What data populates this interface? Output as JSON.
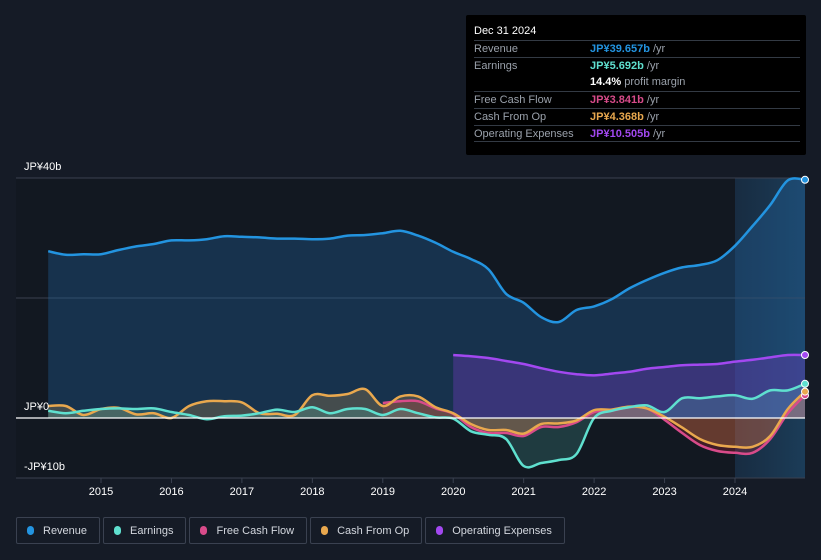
{
  "tooltip": {
    "date": "Dec 31 2024",
    "rows": [
      {
        "label": "Revenue",
        "value": "JP¥39.657b",
        "unit": " /yr",
        "color": "#2394e0"
      },
      {
        "label": "Earnings",
        "value": "JP¥5.692b",
        "unit": " /yr",
        "color": "#5fe0cf"
      },
      {
        "label": "",
        "value": "14.4%",
        "unit": " profit margin",
        "color": "#ffffff"
      },
      {
        "label": "Free Cash Flow",
        "value": "JP¥3.841b",
        "unit": " /yr",
        "color": "#d84b8a"
      },
      {
        "label": "Cash From Op",
        "value": "JP¥4.368b",
        "unit": " /yr",
        "color": "#e9a84e"
      },
      {
        "label": "Operating Expenses",
        "value": "JP¥10.505b",
        "unit": " /yr",
        "color": "#a248f0"
      }
    ]
  },
  "legend": [
    {
      "label": "Revenue",
      "color": "#2394e0"
    },
    {
      "label": "Earnings",
      "color": "#5fe0cf"
    },
    {
      "label": "Free Cash Flow",
      "color": "#d84b8a"
    },
    {
      "label": "Cash From Op",
      "color": "#e9a84e"
    },
    {
      "label": "Operating Expenses",
      "color": "#a248f0"
    }
  ],
  "chart_data": {
    "type": "line",
    "title": "",
    "xlabel": "",
    "ylabel": "",
    "y_tick_labels": [
      "JP¥40b",
      "JP¥0",
      "-JP¥10b"
    ],
    "y_ticks": [
      40,
      0,
      -10
    ],
    "ylim": [
      -10,
      40
    ],
    "xlim": [
      2014.0,
      2025.0
    ],
    "x_tick_labels": [
      "2015",
      "2016",
      "2017",
      "2018",
      "2019",
      "2020",
      "2021",
      "2022",
      "2023",
      "2024"
    ],
    "x_ticks": [
      2015,
      2016,
      2017,
      2018,
      2019,
      2020,
      2021,
      2022,
      2023,
      2024
    ],
    "grid": true,
    "legend_position": "bottom-left",
    "highlight_start": 2024.0,
    "series": [
      {
        "name": "Revenue",
        "color": "#2394e0",
        "x": [
          2014.25,
          2014.5,
          2014.75,
          2015.0,
          2015.25,
          2015.5,
          2015.75,
          2016.0,
          2016.25,
          2016.5,
          2016.75,
          2017.0,
          2017.25,
          2017.5,
          2017.75,
          2018.0,
          2018.25,
          2018.5,
          2018.75,
          2019.0,
          2019.25,
          2019.5,
          2019.75,
          2020.0,
          2020.25,
          2020.5,
          2020.75,
          2021.0,
          2021.25,
          2021.5,
          2021.75,
          2022.0,
          2022.25,
          2022.5,
          2022.75,
          2023.0,
          2023.25,
          2023.5,
          2023.75,
          2024.0,
          2024.25,
          2024.5,
          2024.75,
          2025.0
        ],
        "values": [
          27.8,
          27.2,
          27.3,
          27.3,
          28.0,
          28.6,
          29.0,
          29.6,
          29.6,
          29.8,
          30.3,
          30.2,
          30.1,
          29.9,
          29.9,
          29.8,
          29.9,
          30.4,
          30.5,
          30.8,
          31.2,
          30.4,
          29.2,
          27.7,
          26.5,
          24.8,
          20.7,
          19.2,
          16.8,
          16.0,
          18.0,
          18.6,
          19.8,
          21.6,
          23.0,
          24.2,
          25.1,
          25.5,
          26.3,
          28.7,
          32.0,
          35.5,
          39.6,
          39.7
        ]
      },
      {
        "name": "Earnings",
        "color": "#5fe0cf",
        "x": [
          2014.25,
          2014.5,
          2014.75,
          2015.0,
          2015.25,
          2015.5,
          2015.75,
          2016.0,
          2016.25,
          2016.5,
          2016.75,
          2017.0,
          2017.25,
          2017.5,
          2017.75,
          2018.0,
          2018.25,
          2018.5,
          2018.75,
          2019.0,
          2019.25,
          2019.5,
          2019.75,
          2020.0,
          2020.25,
          2020.5,
          2020.75,
          2021.0,
          2021.25,
          2021.5,
          2021.75,
          2022.0,
          2022.25,
          2022.5,
          2022.75,
          2023.0,
          2023.25,
          2023.5,
          2023.75,
          2024.0,
          2024.25,
          2024.5,
          2024.75,
          2025.0
        ],
        "values": [
          1.2,
          0.8,
          1.2,
          1.5,
          1.6,
          1.5,
          1.6,
          1.0,
          0.5,
          -0.2,
          0.3,
          0.4,
          0.8,
          1.4,
          1.0,
          1.8,
          0.8,
          1.5,
          1.5,
          0.5,
          1.5,
          0.8,
          0.1,
          -0.1,
          -2.2,
          -2.8,
          -3.5,
          -8.0,
          -7.5,
          -7.0,
          -6.0,
          0.0,
          1.2,
          1.8,
          2.1,
          1.0,
          3.3,
          3.3,
          3.6,
          3.8,
          3.2,
          4.6,
          4.6,
          5.7
        ]
      },
      {
        "name": "Free Cash Flow",
        "color": "#d84b8a",
        "x": [
          2019.0,
          2019.25,
          2019.5,
          2019.75,
          2020.0,
          2020.25,
          2020.5,
          2020.75,
          2021.0,
          2021.25,
          2021.5,
          2021.75,
          2022.0,
          2022.25,
          2022.5,
          2022.75,
          2023.0,
          2023.25,
          2023.5,
          2023.75,
          2024.0,
          2024.25,
          2024.5,
          2024.75,
          2025.0
        ],
        "values": [
          2.5,
          2.8,
          2.8,
          1.6,
          0.7,
          -1.5,
          -2.5,
          -2.5,
          -3.0,
          -1.5,
          -1.5,
          -0.7,
          1.0,
          1.2,
          1.8,
          1.6,
          -0.3,
          -2.5,
          -4.5,
          -5.5,
          -5.8,
          -5.8,
          -3.5,
          0.8,
          3.8
        ]
      },
      {
        "name": "Cash From Op",
        "color": "#e9a84e",
        "x": [
          2014.25,
          2014.5,
          2014.75,
          2015.0,
          2015.25,
          2015.5,
          2015.75,
          2016.0,
          2016.25,
          2016.5,
          2016.75,
          2017.0,
          2017.25,
          2017.5,
          2017.75,
          2018.0,
          2018.25,
          2018.5,
          2018.75,
          2019.0,
          2019.25,
          2019.5,
          2019.75,
          2020.0,
          2020.25,
          2020.5,
          2020.75,
          2021.0,
          2021.25,
          2021.5,
          2021.75,
          2022.0,
          2022.25,
          2022.5,
          2022.75,
          2023.0,
          2023.25,
          2023.5,
          2023.75,
          2024.0,
          2024.25,
          2024.5,
          2024.75,
          2025.0
        ],
        "values": [
          2.0,
          2.0,
          0.5,
          1.5,
          1.7,
          0.6,
          0.8,
          0.0,
          2.0,
          2.8,
          2.8,
          2.6,
          0.8,
          0.7,
          0.5,
          3.8,
          3.7,
          4.0,
          4.8,
          2.0,
          3.6,
          3.6,
          1.8,
          0.8,
          -1.0,
          -2.0,
          -2.0,
          -2.6,
          -1.0,
          -0.9,
          -0.4,
          1.3,
          1.4,
          1.9,
          1.6,
          0.2,
          -1.6,
          -3.5,
          -4.5,
          -4.8,
          -4.8,
          -3.0,
          1.5,
          4.4
        ]
      },
      {
        "name": "Operating Expenses",
        "color": "#a248f0",
        "x": [
          2020.0,
          2020.25,
          2020.5,
          2020.75,
          2021.0,
          2021.25,
          2021.5,
          2021.75,
          2022.0,
          2022.25,
          2022.5,
          2022.75,
          2023.0,
          2023.25,
          2023.5,
          2023.75,
          2024.0,
          2024.25,
          2024.5,
          2024.75,
          2025.0
        ],
        "values": [
          10.5,
          10.3,
          10.0,
          9.5,
          9.0,
          8.3,
          7.7,
          7.3,
          7.1,
          7.4,
          7.7,
          8.2,
          8.5,
          8.8,
          8.9,
          9.0,
          9.4,
          9.7,
          10.1,
          10.5,
          10.5
        ]
      }
    ]
  }
}
